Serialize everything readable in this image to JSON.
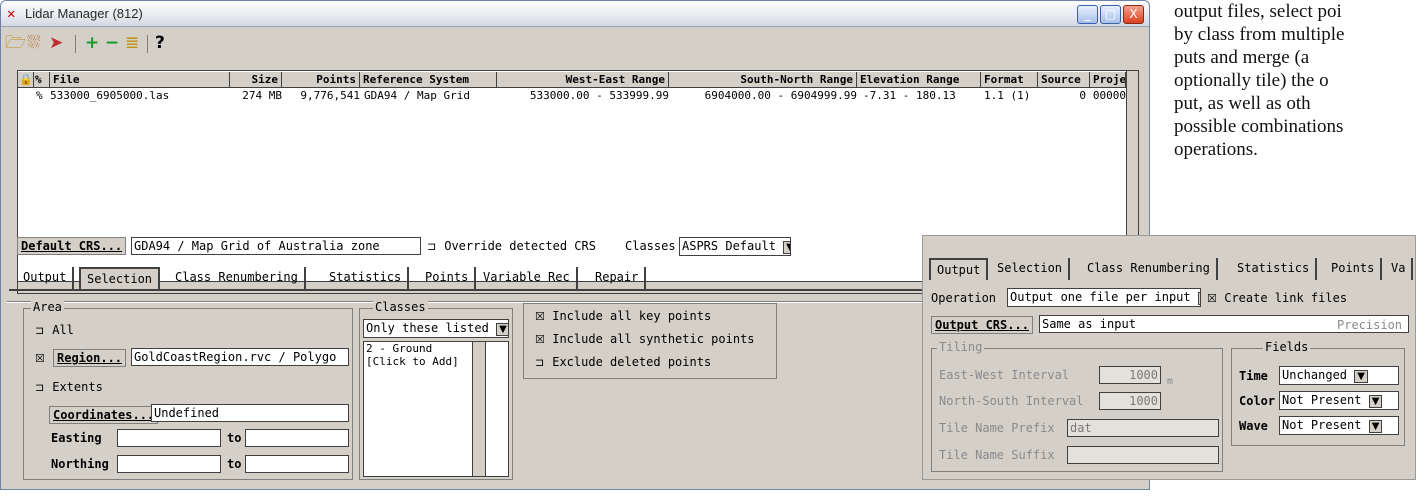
{
  "window": {
    "title": "Lidar Manager (812)",
    "controls": [
      "_",
      "□",
      "X"
    ]
  },
  "toolbar": {
    "icons": [
      "open-folder-icon",
      "filter-icon",
      "export-icon",
      "add-icon",
      "remove-icon",
      "stack-icon",
      "help-icon"
    ],
    "help_label": "?"
  },
  "file_list": {
    "columns": [
      "File",
      "Size",
      "Points",
      "Reference System",
      "West-East Range",
      "South-North Range",
      "Elevation Range",
      "Format",
      "Source",
      "Proje"
    ],
    "rows": [
      {
        "file": "533000_6905000.las",
        "size": "274 MB",
        "points": "9,776,541",
        "reference_system": "GDA94 / Map Grid",
        "west_east": "533000.00 - 533999.99",
        "south_north": "6904000.00 - 6904999.99",
        "elevation": "-7.31 - 180.13",
        "format": "1.1 (1)",
        "source": "0",
        "projection": "00000"
      }
    ]
  },
  "crs_bar": {
    "default_crs_button": "Default CRS...",
    "default_crs_value": "GDA94 / Map Grid of Australia zone",
    "override_label": "Override detected CRS",
    "classes_label": "Classes",
    "classes_value": "ASPRS Default"
  },
  "tabs": [
    "Output",
    "Selection",
    "Class Renumbering",
    "Statistics",
    "Points",
    "Variable Rec",
    "Repair"
  ],
  "active_tab": "Selection",
  "selection": {
    "area_label": "Area",
    "all_label": "All",
    "region_button": "Region...",
    "region_value": "GoldCoastRegion.rvc / Polygo",
    "extents_label": "Extents",
    "coordinates_button": "Coordinates...",
    "coordinates_value": "Undefined",
    "easting_label": "Easting",
    "northing_label": "Northing",
    "to_label": "to",
    "classes_group_label": "Classes",
    "classes_mode": "Only these listed",
    "classes_list": [
      "2 - Ground",
      "[Click to Add]"
    ],
    "include_key_points": "Include all key points",
    "include_synthetic": "Include all synthetic points",
    "exclude_deleted": "Exclude deleted points"
  },
  "inset_output": {
    "tabs": [
      "Output",
      "Selection",
      "Class Renumbering",
      "Statistics",
      "Points",
      "Va"
    ],
    "operation_label": "Operation",
    "operation_value": "Output one file per input",
    "create_link_label": "Create link files",
    "output_crs_button": "Output CRS...",
    "output_crs_value": "Same as input",
    "precision_label": "Precision",
    "tiling_label": "Tiling",
    "ew_interval_label": "East-West Interval",
    "ew_interval_value": "1000",
    "ns_interval_label": "North-South Interval",
    "ns_interval_value": "1000",
    "unit_label": "m",
    "tile_prefix_label": "Tile Name Prefix",
    "tile_prefix_value": "dat",
    "tile_suffix_label": "Tile Name Suffix",
    "tile_suffix_value": "",
    "fields_label": "Fields",
    "time_label": "Time",
    "time_value": "Unchanged",
    "color_label": "Color",
    "color_value": "Not Present",
    "wave_label": "Wave",
    "wave_value": "Not Present"
  },
  "side_note": {
    "lines": [
      "output files, select poi",
      "by class from multiple",
      "puts and merge (a",
      "optionally tile) the o",
      "put, as well as oth",
      "possible combinations",
      "operations."
    ]
  }
}
